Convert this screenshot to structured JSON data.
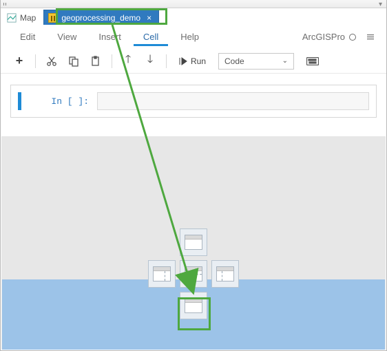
{
  "tabs": {
    "map": {
      "label": "Map"
    },
    "notebook": {
      "label": "geoprocessing_demo"
    }
  },
  "menubar": {
    "edit": "Edit",
    "view": "View",
    "insert": "Insert",
    "cell": "Cell",
    "help": "Help"
  },
  "branding": {
    "label": "ArcGISPro"
  },
  "toolbar": {
    "run_label": "Run",
    "celltype_value": "Code"
  },
  "notebook": {
    "prompt": "In [ ]:"
  }
}
